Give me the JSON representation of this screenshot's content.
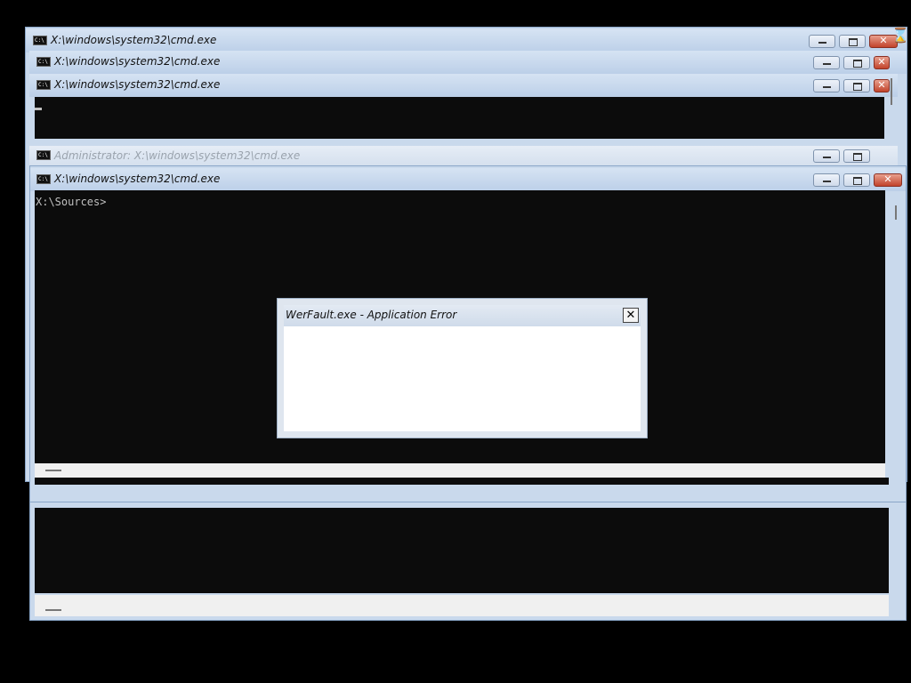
{
  "windows": [
    {
      "title": "X:\\windows\\system32\\cmd.exe"
    },
    {
      "title": "X:\\windows\\system32\\cmd.exe"
    },
    {
      "title": "X:\\windows\\system32\\cmd.exe"
    },
    {
      "title": "Administrator: X:\\windows\\system32\\cmd.exe"
    },
    {
      "title": "X:\\windows\\system32\\cmd.exe",
      "prompt": "X:\\Sources>"
    }
  ],
  "icons": {
    "cmd": "cmd-icon",
    "cmd_icon_text": "C:\\",
    "busy_cursor": "hourglass-cursor-icon"
  },
  "dialog": {
    "title": "WerFault.exe - Application Error",
    "close_label": "✕"
  },
  "colors": {
    "console_bg": "#0c0c0c",
    "title_bar": "#c9d9ec",
    "close_red": "#c2432b"
  }
}
